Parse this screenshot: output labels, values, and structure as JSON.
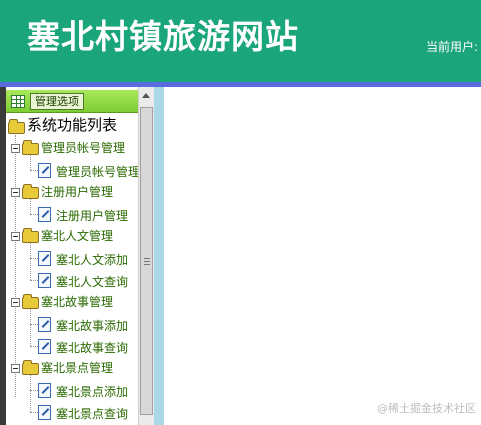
{
  "header": {
    "site_title": "塞北村镇旅游网站",
    "current_user_label": "当前用户:"
  },
  "sidebar": {
    "tab_label": "管理选项",
    "root_label": "系统功能列表",
    "groups": [
      {
        "label": "管理员帐号管理",
        "items": [
          {
            "label": "管理员帐号管理"
          }
        ]
      },
      {
        "label": "注册用户管理",
        "items": [
          {
            "label": "注册用户管理"
          }
        ]
      },
      {
        "label": "塞北人文管理",
        "items": [
          {
            "label": "塞北人文添加"
          },
          {
            "label": "塞北人文查询"
          }
        ]
      },
      {
        "label": "塞北故事管理",
        "items": [
          {
            "label": "塞北故事添加"
          },
          {
            "label": "塞北故事查询"
          }
        ]
      },
      {
        "label": "塞北景点管理",
        "items": [
          {
            "label": "塞北景点添加"
          },
          {
            "label": "塞北景点查询"
          }
        ]
      }
    ]
  },
  "watermark": "@稀土掘金技术社区",
  "colors": {
    "header_bg": "#1aa57a",
    "header_bar": "#5a6be0",
    "sidebar_head": "#8fd840",
    "divider": "#a9d8e6",
    "tree_text": "#2a6a00"
  }
}
